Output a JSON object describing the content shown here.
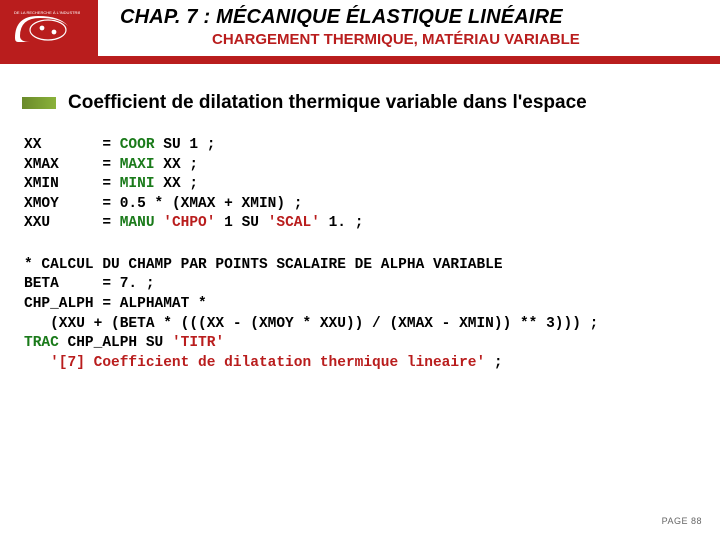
{
  "header": {
    "chapter_title": "CHAP. 7 : MÉCANIQUE ÉLASTIQUE LINÉAIRE",
    "subtitle": "CHARGEMENT THERMIQUE, MATÉRIAU VARIABLE",
    "logo_alt": "cea"
  },
  "section": {
    "title": "Coefficient de dilatation thermique variable dans l'espace"
  },
  "code1": {
    "l1_var": "XX       ",
    "l1_kw": "COOR",
    "l1_rest": " SU 1 ;",
    "l2_var": "XMAX     ",
    "l2_kw": "MAXI",
    "l2_rest": " XX ;",
    "l3_var": "XMIN     ",
    "l3_kw": "MINI",
    "l3_rest": " XX ;",
    "l4_var": "XMOY     ",
    "l4_rest": "0.5 * (XMAX + XMIN) ;",
    "l5_var": "XXU      ",
    "l5_kw": "MANU",
    "l5_s1": "'CHPO'",
    "l5_mid": " 1 SU ",
    "l5_s2": "'SCAL'",
    "l5_end": " 1. ;"
  },
  "code2": {
    "l1": "* CALCUL DU CHAMP PAR POINTS SCALAIRE DE ALPHA VARIABLE",
    "l2": "BETA     = 7. ;",
    "l3": "CHP_ALPH = ALPHAMAT *",
    "l4": "   (XXU + (BETA * (((XX - (XMOY * XXU)) / (XMAX - XMIN)) ** 3))) ;",
    "l5_kw": "TRAC",
    "l5_mid": " CHP_ALPH SU ",
    "l5_s1": "'TITR'",
    "l6_s": "   '[7] Coefficient de dilatation thermique lineaire'",
    "l6_end": " ;"
  },
  "footer": {
    "page": "PAGE 88"
  }
}
